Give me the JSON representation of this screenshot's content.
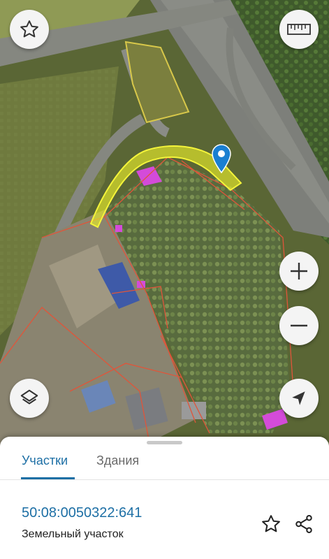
{
  "map": {
    "icons": {
      "favorite": "star-outline-icon",
      "ruler": "ruler-icon",
      "zoom_in": "plus-icon",
      "zoom_out": "minus-icon",
      "layers": "layers-icon",
      "locate": "navigation-arrow-icon",
      "marker": "location-pin-icon"
    },
    "colors": {
      "selected_parcel": "#e8ec2a",
      "parcel_border": "#e0553a",
      "marker": "#1a7fd1",
      "building_highlight": "#d44bd9"
    }
  },
  "sheet": {
    "tabs": [
      {
        "label": "Участки",
        "active": true
      },
      {
        "label": "Здания",
        "active": false
      }
    ],
    "parcel": {
      "cadastral_number": "50:08:0050322:641",
      "type": "Земельный участок"
    },
    "accent_color": "#1d6fa5"
  }
}
